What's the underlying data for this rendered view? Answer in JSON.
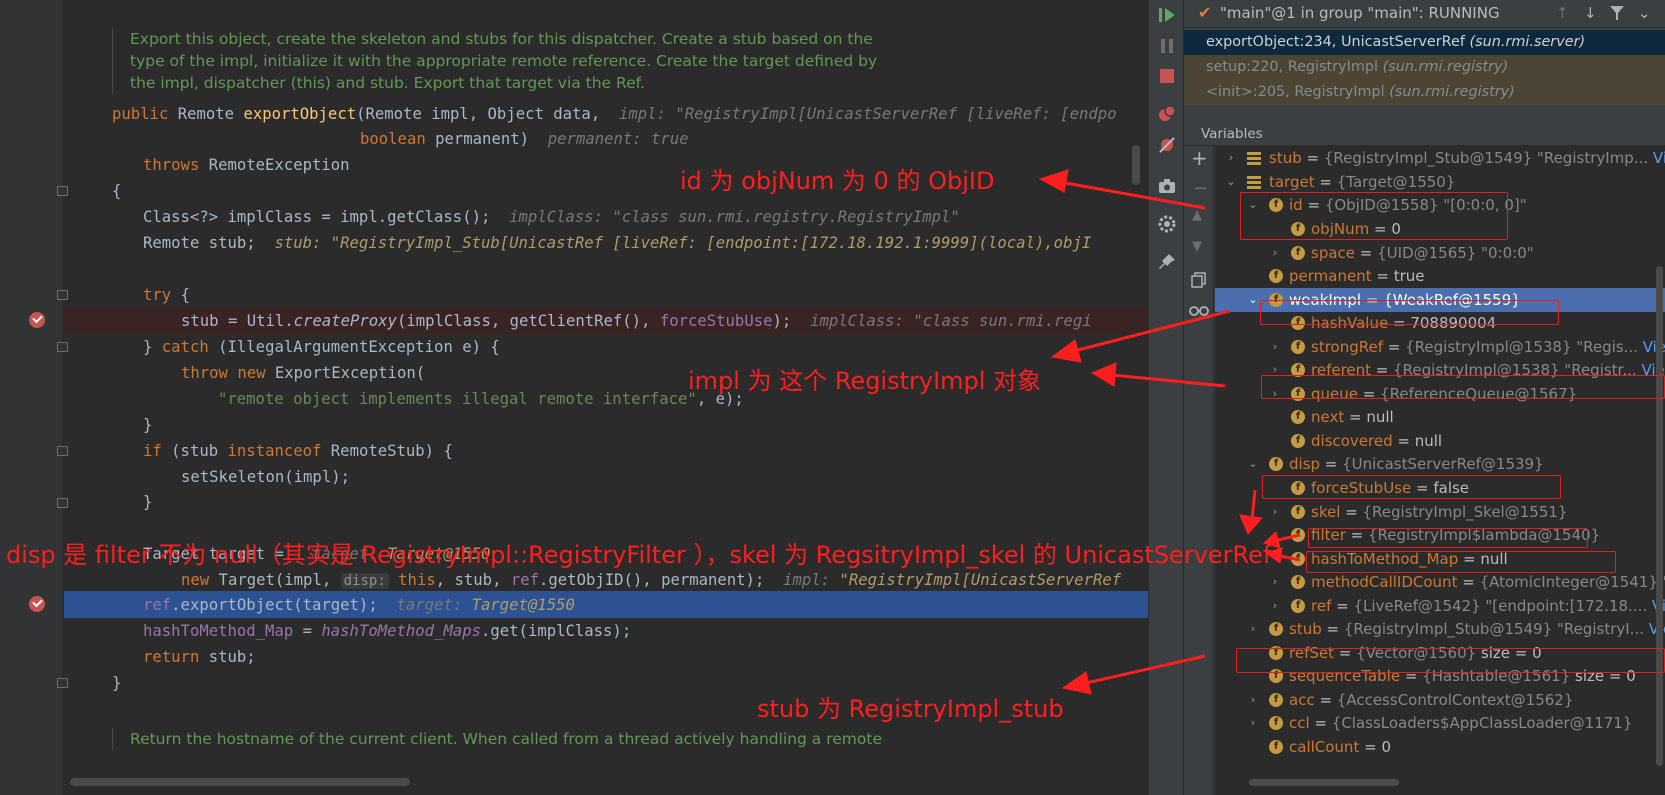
{
  "editor": {
    "doc_top": "Export this object, create the skeleton and stubs for this dispatcher. Create a stub based on the type of the impl, initialize it with the appropriate remote reference. Create the target defined by the impl, dispatcher (this) and stub. Export that target via the Ref.",
    "doc_bottom": "Return the hostname of the current client. When called from a thread actively handling a remote",
    "code": {
      "l1_kw": "public ",
      "l1_a": "Remote ",
      "l1_fn": "exportObject",
      "l1_b": "(Remote impl, Object data,",
      "l1_hint": "impl: \"RegistryImpl[UnicastServerRef [liveRef: [endpo",
      "l2_kw": "boolean ",
      "l2_a": "permanent)",
      "l2_hint": "permanent: true",
      "l3_kw": "throws ",
      "l3_a": "RemoteException",
      "l4": "{",
      "l5_a": "Class<?> implClass = impl.getClass();",
      "l5_hint": "implClass: \"class sun.rmi.registry.RegistryImpl\"",
      "l6_a": "Remote stub;",
      "l6_hint": "stub: \"RegistryImpl_Stub[UnicastRef [liveRef: [endpoint:[172.18.192.1:9999](local),objI",
      "l7_kw": "try ",
      "l7_a": "{",
      "l8_a": "stub = Util.",
      "l8_it": "createProxy",
      "l8_b": "(implClass, getClientRef(), ",
      "l8_field": "forceStubUse",
      "l8_c": ");",
      "l8_hint": "implClass: \"class sun.rmi.regi",
      "l9_a": "} ",
      "l9_kw": "catch ",
      "l9_b": "(IllegalArgumentException e) {",
      "l10_kw": "throw new ",
      "l10_a": "ExportException(",
      "l11_str": "\"remote object implements illegal remote interface\"",
      "l11_a": ", e);",
      "l12": "}",
      "l13_kw": "if ",
      "l13_a": "(stub ",
      "l13_kw2": "instanceof ",
      "l13_b": "RemoteStub) {",
      "l14_a": "setSkeleton(impl);",
      "l15": "}",
      "l16_a": "Target target =",
      "l16_hint": "target: ",
      "l16_hintv": "Target@1550",
      "l17_kw": "new ",
      "l17_a": "Target(impl,",
      "l17_param": "disp:",
      "l17_kw2": " this",
      "l17_b": ", stub, ",
      "l17_field": "ref",
      "l17_c": ".getObjID(), permanent);",
      "l17_hint": "impl: ",
      "l17_hintv": "\"RegistryImpl[UnicastServerRef",
      "l18_field": "ref",
      "l18_a": ".exportObject(target);",
      "l18_hint": "target: ",
      "l18_hintv": "Target@1550",
      "l19_field": "hashToMethod_Map",
      "l19_a": " = ",
      "l19_field2": "hashToMethod_Maps",
      "l19_b": ".get(implClass);",
      "l20_kw": "return ",
      "l20_a": "stub;",
      "l21": "}"
    }
  },
  "debugger": {
    "thread": "\"main\"@1 in group \"main\": RUNNING",
    "frames": [
      {
        "method": "exportObject:234, UnicastServerRef",
        "pkg": "(sun.rmi.server)"
      },
      {
        "method": "setup:220, RegistryImpl",
        "pkg": "(sun.rmi.registry)"
      },
      {
        "method": "<init>:205, RegistryImpl",
        "pkg": "(sun.rmi.registry)"
      }
    ],
    "variables_title": "Variables",
    "vars": {
      "stub_top": {
        "name": "stub",
        "value": "{RegistryImpl_Stub@1549} \"RegistryImp...",
        "link": "View"
      },
      "target": {
        "name": "target",
        "value": "{Target@1550}"
      },
      "id": {
        "name": "id",
        "value": "{ObjID@1558} \"[0:0:0, 0]\""
      },
      "objNum": {
        "name": "objNum",
        "value": "0"
      },
      "space": {
        "name": "space",
        "value": "{UID@1565} \"0:0:0\""
      },
      "permanent": {
        "name": "permanent",
        "value": "true"
      },
      "weakImpl": {
        "name": "weakImpl",
        "value": "{WeakRef@1559}"
      },
      "hashValue": {
        "name": "hashValue",
        "value": "708890004"
      },
      "strongRef": {
        "name": "strongRef",
        "value": "{RegistryImpl@1538} \"Regis...",
        "link": "View"
      },
      "referent": {
        "name": "referent",
        "value": "{RegistryImpl@1538} \"Registr...",
        "link": "View"
      },
      "queue": {
        "name": "queue",
        "value": "{ReferenceQueue@1567}"
      },
      "next": {
        "name": "next",
        "value": "null"
      },
      "discovered": {
        "name": "discovered",
        "value": "null"
      },
      "disp": {
        "name": "disp",
        "value": "{UnicastServerRef@1539}"
      },
      "forceStubUse": {
        "name": "forceStubUse",
        "value": "false"
      },
      "skel": {
        "name": "skel",
        "value": "{RegistryImpl_Skel@1551}"
      },
      "filter": {
        "name": "filter",
        "value": "{RegistryImpl$lambda@1540}"
      },
      "hashToMethod_Map": {
        "name": "hashToMethod_Map",
        "value": "null"
      },
      "methodCallIDCount": {
        "name": "methodCallIDCount",
        "value": "{AtomicInteger@1541} \"0"
      },
      "ref": {
        "name": "ref",
        "value": "{LiveRef@1542} \"[endpoint:[172.18....",
        "link": "View"
      },
      "stub": {
        "name": "stub",
        "value": "{RegistryImpl_Stub@1549} \"RegistryI...",
        "link": "View"
      },
      "refSet": {
        "name": "refSet",
        "value": "{Vector@1560}",
        "extra": "size = 0"
      },
      "sequenceTable": {
        "name": "sequenceTable",
        "value": "{Hashtable@1561}",
        "extra": "size = 0"
      },
      "acc": {
        "name": "acc",
        "value": "{AccessControlContext@1562}"
      },
      "ccl": {
        "name": "ccl",
        "value": "{ClassLoaders$AppClassLoader@1171}"
      },
      "callCount": {
        "name": "callCount",
        "value": "0"
      }
    }
  },
  "annotations": {
    "a1": "id 为 objNum 为 0 的 ObjID",
    "a2": "impl 为 这个 RegistryImpl 对象",
    "a3": "disp 是 filter 不为 null（其实是 RegistryImpl::RegistryFilter ），skel 为 RegsitryImpl_skel 的 UnicastServerRef",
    "a4": "stub 为 RegistryImpl_stub"
  },
  "colors": {
    "annotation": "#ff1e1e",
    "selection": "#4b6eaf",
    "breakpoint": "#c75450"
  }
}
